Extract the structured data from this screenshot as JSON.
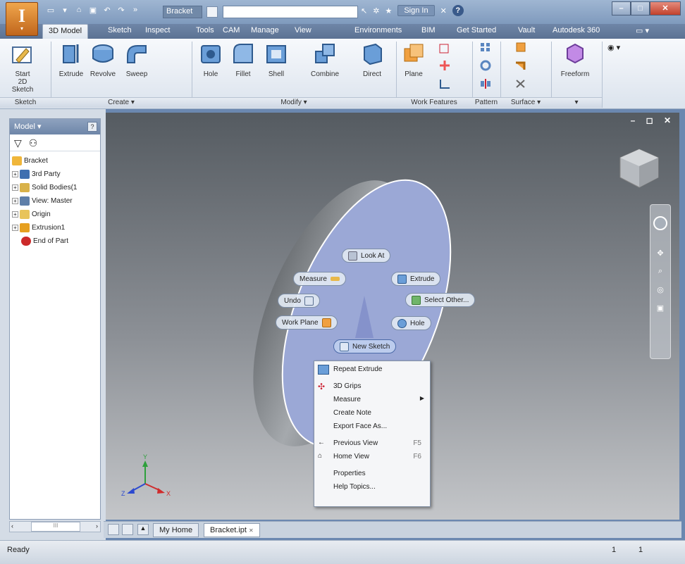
{
  "titlebar": {
    "app_button_glyph": "I",
    "document_title": "Bracket",
    "sign_in": "Sign In",
    "help_glyph": "?",
    "close_glyph": "✕",
    "minimize_glyph": "–",
    "maximize_glyph": "□"
  },
  "tabs": [
    {
      "label": "3D Model"
    },
    {
      "label": "Sketch"
    },
    {
      "label": "Inspect"
    },
    {
      "label": "Tools"
    },
    {
      "label": "CAM"
    },
    {
      "label": "Manage"
    },
    {
      "label": "View"
    },
    {
      "label": "Environments"
    },
    {
      "label": "BIM"
    },
    {
      "label": "Get Started"
    },
    {
      "label": "Vault"
    },
    {
      "label": "Autodesk 360"
    }
  ],
  "ribbon": {
    "start_sketch": "Start\n2D Sketch",
    "extrude": "Extrude",
    "revolve": "Revolve",
    "sweep": "Sweep",
    "hole": "Hole",
    "fillet": "Fillet",
    "shell": "Shell",
    "combine": "Combine",
    "direct": "Direct",
    "plane": "Plane",
    "freeform": "Freeform",
    "groups": {
      "sketch": "Sketch",
      "create": "Create ▾",
      "modify": "Modify ▾",
      "work_features": "Work Features",
      "pattern": "Pattern",
      "surface": "Surface ▾",
      "freeform": "▾"
    }
  },
  "browser": {
    "title": "Model ▾",
    "help": "?",
    "items": [
      {
        "label": "Bracket",
        "color": "#f0b63a"
      },
      {
        "label": "3rd Party",
        "color": "#3f6fb0"
      },
      {
        "label": "Solid Bodies(1",
        "color": "#d9b24a"
      },
      {
        "label": "View: Master",
        "color": "#5f7fa8"
      },
      {
        "label": "Origin",
        "color": "#e8c45a"
      },
      {
        "label": "Extrusion1",
        "color": "#e6a020"
      },
      {
        "label": "End of Part",
        "color": "#cc2a2a"
      }
    ],
    "scroll_label": "III"
  },
  "marking_menu": {
    "look_at": "Look At",
    "measure": "Measure",
    "extrude": "Extrude",
    "undo": "Undo",
    "select_other": "Select Other...",
    "work_plane": "Work Plane",
    "hole": "Hole",
    "new_sketch": "New Sketch"
  },
  "context_menu": {
    "repeat_extrude": "Repeat Extrude",
    "grips": "3D Grips",
    "measure": "Measure",
    "create_note": "Create Note",
    "export_face": "Export Face As...",
    "previous_view": "Previous View",
    "previous_view_key": "F5",
    "home_view": "Home View",
    "home_view_key": "F6",
    "properties": "Properties",
    "help_topics": "Help Topics..."
  },
  "doc_tabs": {
    "home": "My Home",
    "part": "Bracket.ipt",
    "close": "✕"
  },
  "status": {
    "text": "Ready",
    "n1": "1",
    "n2": "1"
  },
  "viewport": {
    "controls": "– ◻ ✕",
    "triad_x": "X",
    "triad_y": "Y",
    "triad_z": "Z"
  },
  "colors": {
    "face_highlight": "#9ba8d6",
    "part_grey": "#9a9ea3",
    "accent_orange": "#e0892c"
  }
}
